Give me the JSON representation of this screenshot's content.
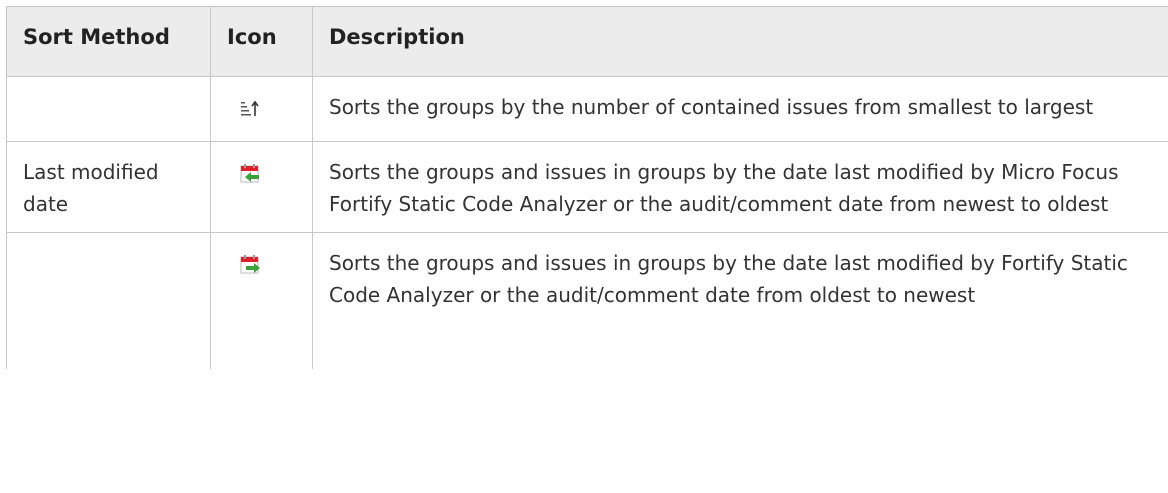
{
  "table": {
    "headers": [
      "Sort Method",
      "Icon",
      "Description"
    ],
    "rows": [
      {
        "method": "",
        "icon": "sort-by-count-ascending-icon",
        "description": "Sorts the groups by the number of contained issues from smallest to largest"
      },
      {
        "method": "Last modified date",
        "icon": "calendar-arrow-left-icon",
        "description": "Sorts the groups and issues in groups by the date last modified by Micro Focus Fortify Static Code Analyzer or the audit/comment date from newest to oldest"
      },
      {
        "method": "",
        "icon": "calendar-arrow-right-icon",
        "description": "Sorts the groups and issues in groups by the date last modified by Fortify Static Code Analyzer or the audit/comment date from oldest to newest"
      }
    ]
  },
  "colors": {
    "header_bg": "#ececec",
    "border": "#c8c8c8",
    "calendar_red": "#e0202a",
    "arrow_green": "#3aa43a"
  }
}
